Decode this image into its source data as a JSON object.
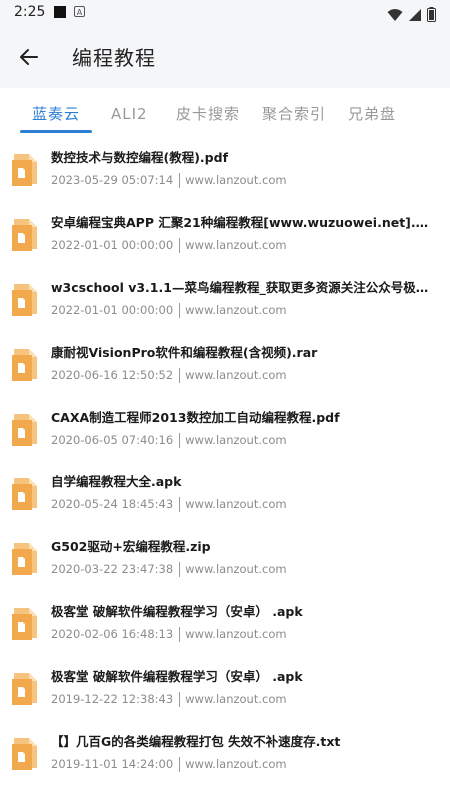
{
  "status": {
    "time": "2:25",
    "a_label": "A"
  },
  "header": {
    "title": "编程教程",
    "back_icon": "arrow-left-icon"
  },
  "tabs": [
    {
      "label": "蓝奏云",
      "active": true
    },
    {
      "label": "ALI2",
      "active": false
    },
    {
      "label": "皮卡搜索",
      "active": false
    },
    {
      "label": "聚合索引",
      "active": false
    },
    {
      "label": "兄弟盘",
      "active": false
    }
  ],
  "colors": {
    "accent": "#2d7fd6",
    "file_icon": "#f4b55e",
    "file_icon_dark": "#e89a3c"
  },
  "files": [
    {
      "name": "数控技术与数控编程(教程).pdf",
      "date": "2023-05-29 05:07:14",
      "source": "www.lanzout.com"
    },
    {
      "name": "安卓编程宝典APP 汇聚21种编程教程[www.wuzuowei.net].apk",
      "date": "2022-01-01 00:00:00",
      "source": "www.lanzout.com"
    },
    {
      "name": "w3cschool v3.1.1—菜鸟编程教程_获取更多资源关注公众号极客喵荐....",
      "date": "2022-01-01 00:00:00",
      "source": "www.lanzout.com"
    },
    {
      "name": "康耐视VisionPro软件和编程教程(含视频).rar",
      "date": "2020-06-16 12:50:52",
      "source": "www.lanzout.com"
    },
    {
      "name": "CAXA制造工程师2013数控加工自动编程教程.pdf",
      "date": "2020-06-05 07:40:16",
      "source": "www.lanzout.com"
    },
    {
      "name": "自学编程教程大全.apk",
      "date": "2020-05-24 18:45:43",
      "source": "www.lanzout.com"
    },
    {
      "name": "G502驱动+宏编程教程.zip",
      "date": "2020-03-22 23:47:38",
      "source": "www.lanzout.com"
    },
    {
      "name": "极客堂 破解软件编程教程学习（安卓） .apk",
      "date": "2020-02-06 16:48:13",
      "source": "www.lanzout.com"
    },
    {
      "name": "极客堂 破解软件编程教程学习（安卓） .apk",
      "date": "2019-12-22 12:38:43",
      "source": "www.lanzout.com"
    },
    {
      "name": "【】几百G的各类编程教程打包 失效不补速度存.txt",
      "date": "2019-11-01 14:24:00",
      "source": "www.lanzout.com"
    }
  ]
}
